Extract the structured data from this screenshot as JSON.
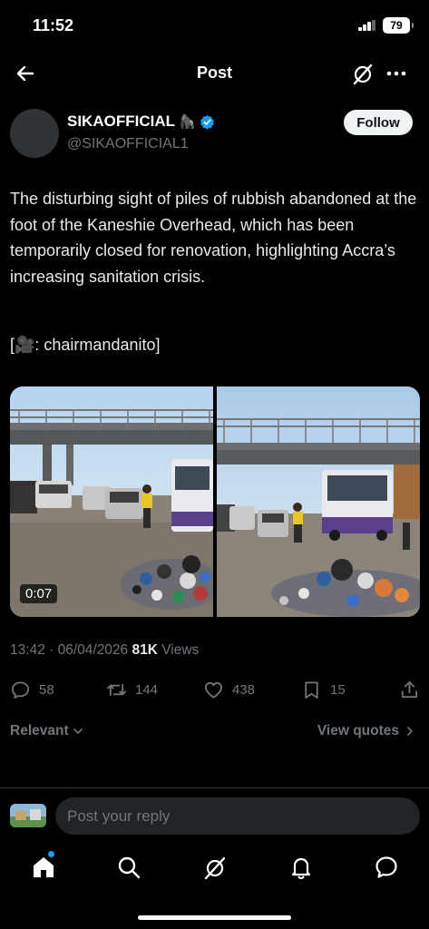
{
  "status": {
    "time": "11:52",
    "battery": "79"
  },
  "header": {
    "title": "Post"
  },
  "author": {
    "name": "SIKAOFFICIAL",
    "name_emoji": "🦍",
    "handle": "@SIKAOFFICIAL1",
    "follow_label": "Follow"
  },
  "tweet": {
    "text": "The disturbing sight of piles of rubbish abandoned at the foot of the Kaneshie Overhead, which has been temporarily closed for renovation, highlighting Accra’s increasing sanitation crisis.",
    "credit": "[🎥: chairmandanito]",
    "video_duration": "0:07"
  },
  "meta": {
    "time": "13:42",
    "separator": "·",
    "date": "06/04/2026",
    "views_count": "81K",
    "views_label": "Views"
  },
  "actions": {
    "replies": "58",
    "reposts": "144",
    "likes": "438",
    "bookmarks": "15"
  },
  "sort": {
    "label": "Relevant"
  },
  "quotes": {
    "label": "View quotes"
  },
  "reply": {
    "placeholder": "Post your reply"
  },
  "colors": {
    "background": "#000000",
    "text": "#e7e9ea",
    "muted": "#71767b",
    "accent": "#1d9bf0",
    "verified": "#1d9bf0",
    "input_bg": "#202327"
  },
  "icons": {
    "back": "arrow-left-icon",
    "grok": "grok-icon",
    "more": "more-icon",
    "reply": "reply-icon",
    "repost": "repost-icon",
    "like": "heart-icon",
    "bookmark": "bookmark-icon",
    "share": "share-icon",
    "home": "home-icon",
    "search": "search-icon",
    "notifications": "bell-icon",
    "messages": "messages-icon"
  }
}
